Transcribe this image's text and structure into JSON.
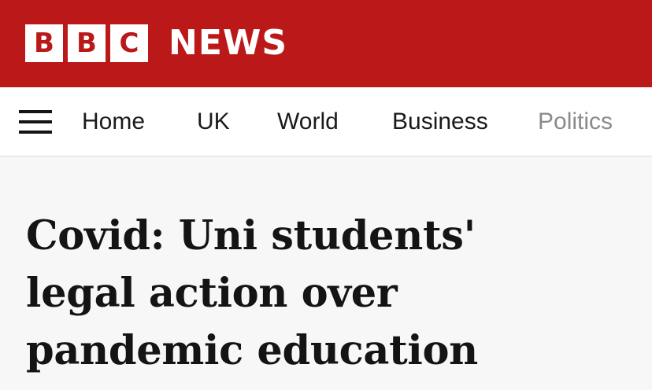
{
  "masthead": {
    "logo_letters": [
      "B",
      "B",
      "C"
    ],
    "section_title": "NEWS",
    "brand_color": "#bb1919"
  },
  "nav": {
    "menu_icon": "hamburger-menu-icon",
    "items": [
      {
        "label": "Home"
      },
      {
        "label": "UK"
      },
      {
        "label": "World"
      },
      {
        "label": "Business"
      },
      {
        "label": "Politics"
      }
    ]
  },
  "article": {
    "headline_lines": [
      "Covid: Uni students'",
      "legal action over",
      "pandemic education"
    ]
  }
}
